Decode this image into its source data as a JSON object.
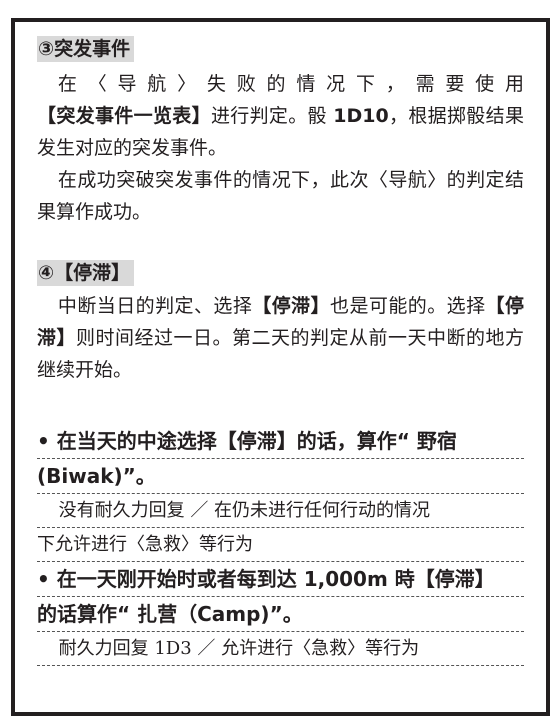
{
  "section_navigation_event": {
    "heading": "③突发事件",
    "para1_a": "在〈导航〉失败的情况下，需要使用",
    "para1_bold": "【突发事件一览表】",
    "para1_b": "进行判定。骰 ",
    "para1_dice": "1D10",
    "para1_c": "，根据掷骰结果发生对应的突发事件。",
    "para2": "在成功突破突发事件的情况下，此次〈导航〉的判定结果算作成功。"
  },
  "section_stagnation": {
    "heading": "④【停滞】",
    "para_a": "中断当日的判定、选择",
    "para_bold1": "【停滞】",
    "para_b": "也是可能的。选择",
    "para_bold2": "【停滞】",
    "para_c": "则时间经过一日。第二天的判定从前一天中断的地方继续开始。"
  },
  "bullets": [
    {
      "line1": "• 在当天的中途选择【停滞】的话，算作“ 野宿",
      "line2": "(Biwak)”。",
      "note1": "没有耐久力回复 ／ 在仍未进行任何行动的情况",
      "note2": "下允许进行〈急救〉等行为"
    },
    {
      "line1": "• 在一天刚开始时或者每到达 1,000m 時【停滞】",
      "line2": "的话算作“ 扎营（Camp)”。",
      "note1": "耐久力回复 1D3 ／ 允许进行〈急救〉等行为"
    }
  ]
}
